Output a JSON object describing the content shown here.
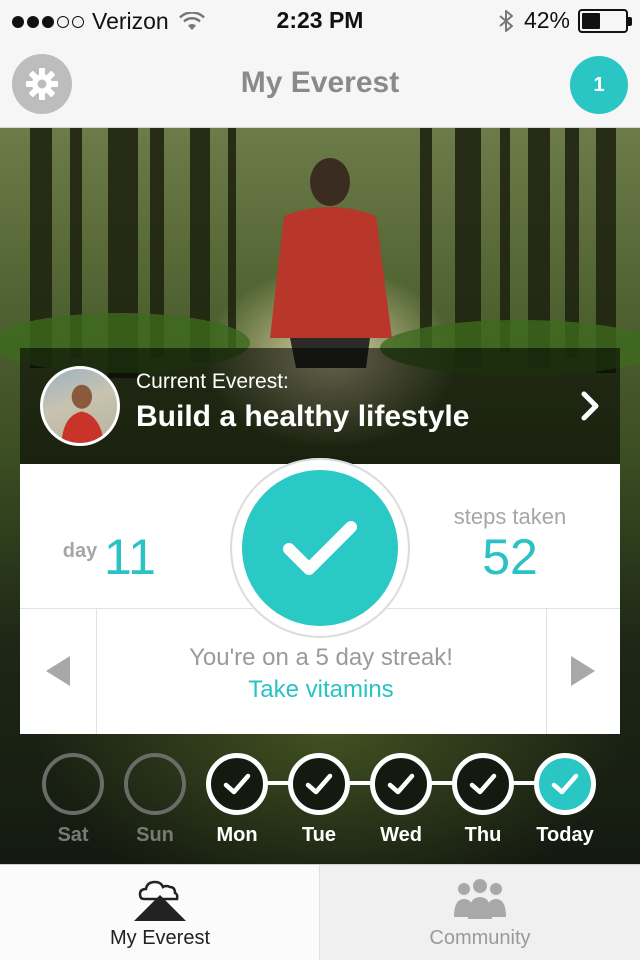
{
  "status_bar": {
    "carrier": "Verizon",
    "time": "2:23 PM",
    "battery": "42%",
    "battery_level": 0.42
  },
  "nav": {
    "title": "My Everest",
    "badge_count": "1",
    "settings_icon": "gear-icon"
  },
  "everest": {
    "label": "Current Everest:",
    "goal": "Build a healthy lifestyle"
  },
  "stats": {
    "day_label": "day",
    "day_value": "11",
    "steps_label": "steps taken",
    "steps_value": "52",
    "streak_text": "You're on a 5 day streak!",
    "habit": "Take vitamins"
  },
  "week": [
    {
      "label": "Sat",
      "state": "empty"
    },
    {
      "label": "Sun",
      "state": "empty"
    },
    {
      "label": "Mon",
      "state": "done"
    },
    {
      "label": "Tue",
      "state": "done"
    },
    {
      "label": "Wed",
      "state": "done"
    },
    {
      "label": "Thu",
      "state": "done"
    },
    {
      "label": "Today",
      "state": "today"
    }
  ],
  "tabs": [
    {
      "label": "My Everest",
      "icon": "mountain-cloud-icon",
      "active": true
    },
    {
      "label": "Community",
      "icon": "people-icon",
      "active": false
    }
  ],
  "colors": {
    "accent": "#2ac9c6",
    "nav_bg": "#f6f6f6",
    "muted_text": "#a6a6a6"
  }
}
